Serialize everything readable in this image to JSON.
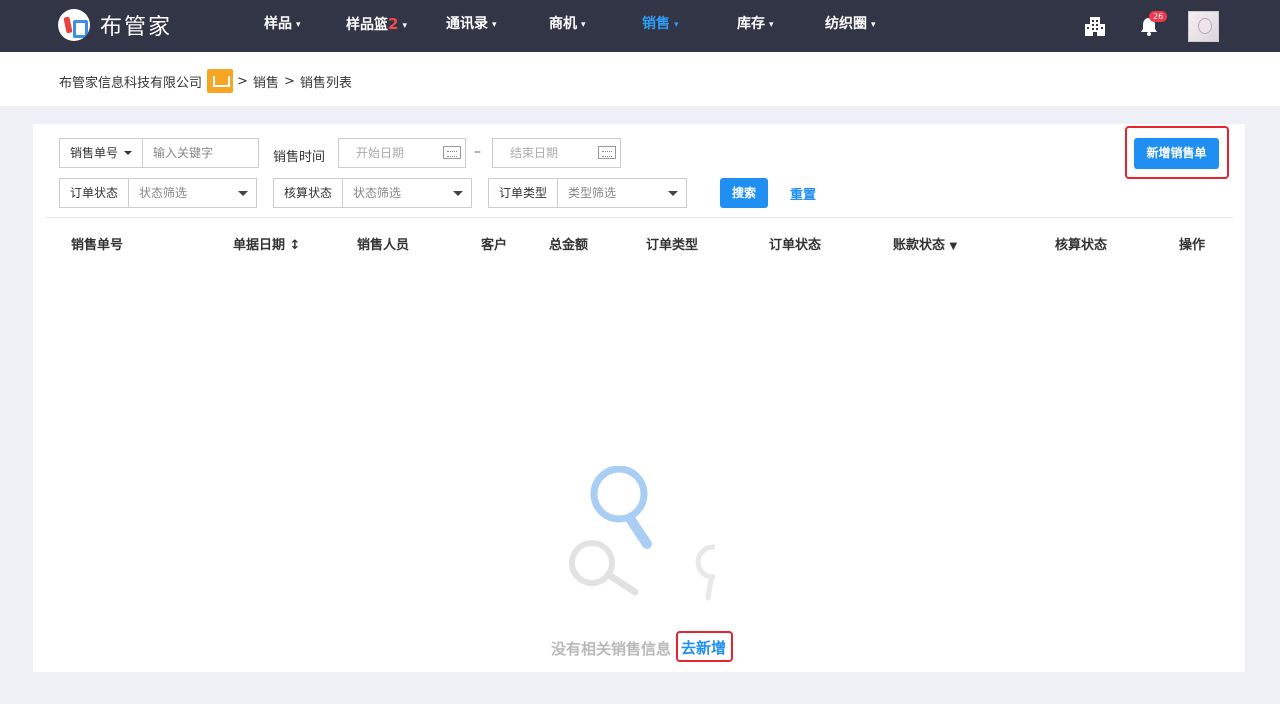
{
  "app": {
    "name": "布管家"
  },
  "nav": {
    "items": [
      {
        "label": "样品",
        "caret": "▾"
      },
      {
        "label": "样品篮",
        "count": "2",
        "caret": "▾"
      },
      {
        "label": "通讯录",
        "caret": "▾"
      },
      {
        "label": "商机",
        "caret": "▾"
      },
      {
        "label": "销售",
        "caret": "▾",
        "active": true
      },
      {
        "label": "库存",
        "caret": "▾"
      },
      {
        "label": "纺织圈",
        "caret": "▾"
      }
    ],
    "notification_count": "26",
    "icons": [
      "building-icon",
      "bell-icon",
      "avatar"
    ]
  },
  "breadcrumb": {
    "company": "布管家信息科技有限公司",
    "sep1": ">",
    "section": "销售",
    "sep2": ">",
    "page": "销售列表"
  },
  "filters": {
    "order_no_label": "销售单号",
    "order_no_placeholder": "输入关键字",
    "sale_time_label": "销售时间",
    "start_date_placeholder": "开始日期",
    "range_sep": "–",
    "end_date_placeholder": "结束日期",
    "order_status_label": "订单状态",
    "order_status_value": "状态筛选",
    "settle_status_label": "核算状态",
    "settle_status_value": "状态筛选",
    "order_type_label": "订单类型",
    "order_type_value": "类型筛选",
    "search_button": "搜索",
    "reset_link": "重置",
    "new_button": "新增销售单"
  },
  "table": {
    "columns": [
      "销售单号",
      "单据日期",
      "销售人员",
      "客户",
      "总金额",
      "订单类型",
      "订单状态",
      "账款状态",
      "核算状态",
      "操作"
    ],
    "sort_icon": "↕",
    "filter_icon": "▼"
  },
  "empty": {
    "message": "没有相关销售信息",
    "action": "去新增"
  },
  "colors": {
    "accent": "#1f8ff2",
    "nav_bg": "#323545",
    "highlight": "#e7232d"
  }
}
